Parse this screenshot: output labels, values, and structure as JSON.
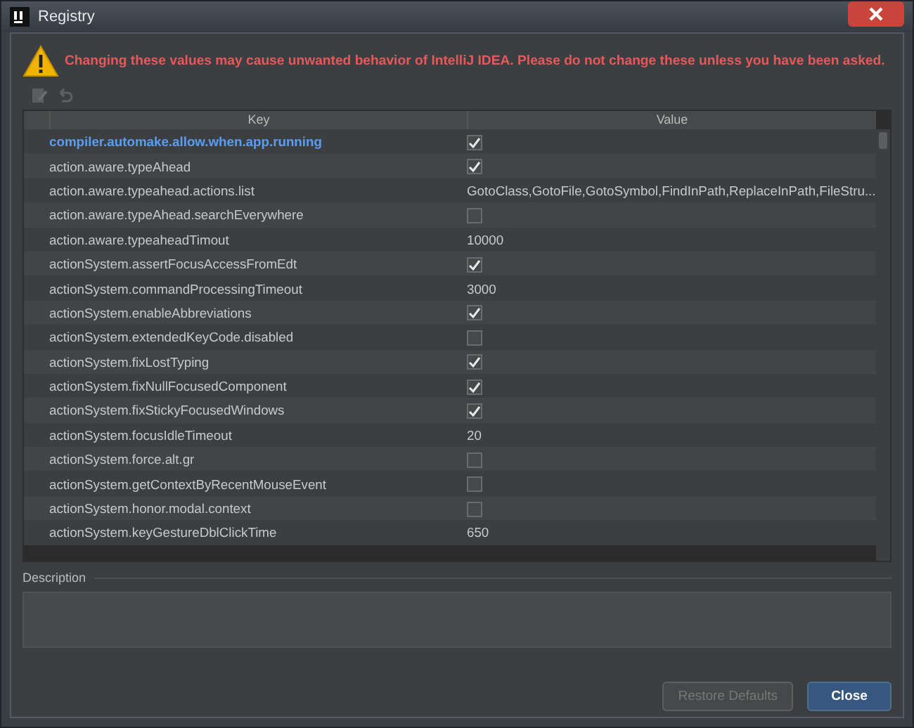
{
  "window": {
    "title": "Registry"
  },
  "warning": "Changing these values may cause unwanted behavior of IntelliJ IDEA. Please do not change these unless you have been asked.",
  "table": {
    "columns": [
      "Key",
      "Value"
    ],
    "rows": [
      {
        "key": "compiler.automake.allow.when.app.running",
        "kind": "checkbox",
        "checked": true,
        "modified": true
      },
      {
        "key": "action.aware.typeAhead",
        "kind": "checkbox",
        "checked": true,
        "modified": false
      },
      {
        "key": "action.aware.typeahead.actions.list",
        "kind": "text",
        "value": "GotoClass,GotoFile,GotoSymbol,FindInPath,ReplaceInPath,FileStru...",
        "modified": false
      },
      {
        "key": "action.aware.typeAhead.searchEverywhere",
        "kind": "checkbox",
        "checked": false,
        "modified": false
      },
      {
        "key": "action.aware.typeaheadTimout",
        "kind": "text",
        "value": "10000",
        "modified": false
      },
      {
        "key": "actionSystem.assertFocusAccessFromEdt",
        "kind": "checkbox",
        "checked": true,
        "modified": false
      },
      {
        "key": "actionSystem.commandProcessingTimeout",
        "kind": "text",
        "value": "3000",
        "modified": false
      },
      {
        "key": "actionSystem.enableAbbreviations",
        "kind": "checkbox",
        "checked": true,
        "modified": false
      },
      {
        "key": "actionSystem.extendedKeyCode.disabled",
        "kind": "checkbox",
        "checked": false,
        "modified": false
      },
      {
        "key": "actionSystem.fixLostTyping",
        "kind": "checkbox",
        "checked": true,
        "modified": false
      },
      {
        "key": "actionSystem.fixNullFocusedComponent",
        "kind": "checkbox",
        "checked": true,
        "modified": false
      },
      {
        "key": "actionSystem.fixStickyFocusedWindows",
        "kind": "checkbox",
        "checked": true,
        "modified": false
      },
      {
        "key": "actionSystem.focusIdleTimeout",
        "kind": "text",
        "value": "20",
        "modified": false
      },
      {
        "key": "actionSystem.force.alt.gr",
        "kind": "checkbox",
        "checked": false,
        "modified": false
      },
      {
        "key": "actionSystem.getContextByRecentMouseEvent",
        "kind": "checkbox",
        "checked": false,
        "modified": false
      },
      {
        "key": "actionSystem.honor.modal.context",
        "kind": "checkbox",
        "checked": false,
        "modified": false
      },
      {
        "key": "actionSystem.keyGestureDblClickTime",
        "kind": "text",
        "value": "650",
        "modified": false
      }
    ]
  },
  "description": {
    "label": "Description"
  },
  "buttons": [
    {
      "label": "Restore Defaults",
      "disabled": true,
      "default": false
    },
    {
      "label": "Close",
      "disabled": false,
      "default": true
    }
  ]
}
